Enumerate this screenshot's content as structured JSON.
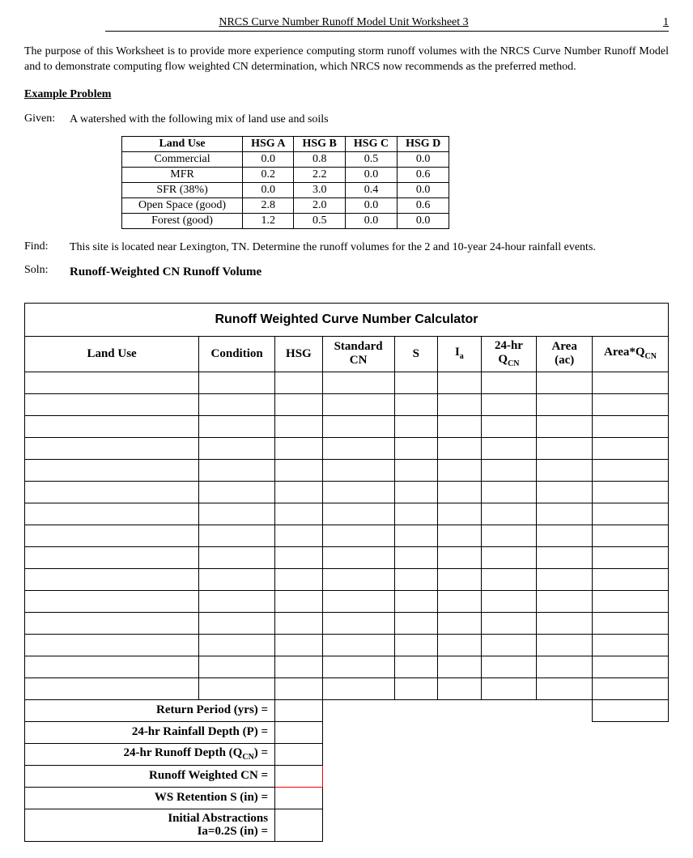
{
  "header": {
    "title": "NRCS Curve Number Runoff Model Unit Worksheet 3",
    "page": "1"
  },
  "intro": "The purpose of this Worksheet is to provide more experience computing storm runoff volumes with the NRCS Curve Number Runoff Model and to demonstrate computing flow weighted CN determination, which NRCS now recommends as the preferred method.",
  "example_heading": "Example Problem",
  "given": {
    "label": "Given:",
    "text": "A watershed with the following mix of land use and soils"
  },
  "landuse_table": {
    "headers": [
      "Land Use",
      "HSG A",
      "HSG B",
      "HSG C",
      "HSG D"
    ],
    "rows": [
      [
        "Commercial",
        "0.0",
        "0.8",
        "0.5",
        "0.0"
      ],
      [
        "MFR",
        "0.2",
        "2.2",
        "0.0",
        "0.6"
      ],
      [
        "SFR (38%)",
        "0.0",
        "3.0",
        "0.4",
        "0.0"
      ],
      [
        "Open Space (good)",
        "2.8",
        "2.0",
        "0.0",
        "0.6"
      ],
      [
        "Forest (good)",
        "1.2",
        "0.5",
        "0.0",
        "0.0"
      ]
    ]
  },
  "find": {
    "label": "Find:",
    "text": "This site is located near Lexington, TN.  Determine the runoff volumes for the 2 and 10-year 24-hour rainfall events."
  },
  "soln": {
    "label": "Soln:",
    "text": "Runoff-Weighted CN Runoff Volume"
  },
  "calc": {
    "title": "Runoff Weighted Curve Number Calculator",
    "headers": {
      "land_use": "Land Use",
      "condition": "Condition",
      "hsg": "HSG",
      "std_cn": "Standard CN",
      "s": "S",
      "ia": "Iₐ",
      "qcn": "24-hr Q",
      "qcn_sub": "CN",
      "area": "Area (ac)",
      "area_qcn": "Area*Q",
      "area_qcn_sub": "CN"
    },
    "blank_rows": 15,
    "summary": {
      "return_period": "Return Period (yrs) =",
      "rainfall_depth": "24-hr Rainfall Depth (P) =",
      "runoff_depth_prefix": "24-hr Runoff Depth (Q",
      "runoff_depth_sub": "CN",
      "runoff_depth_suffix": ") =",
      "weighted_cn": "Runoff Weighted CN =",
      "retention": "WS Retention S (in) =",
      "initial_abs_line1": "Initial Abstractions",
      "initial_abs_line2": "Ia=0.2S (in) ="
    }
  }
}
